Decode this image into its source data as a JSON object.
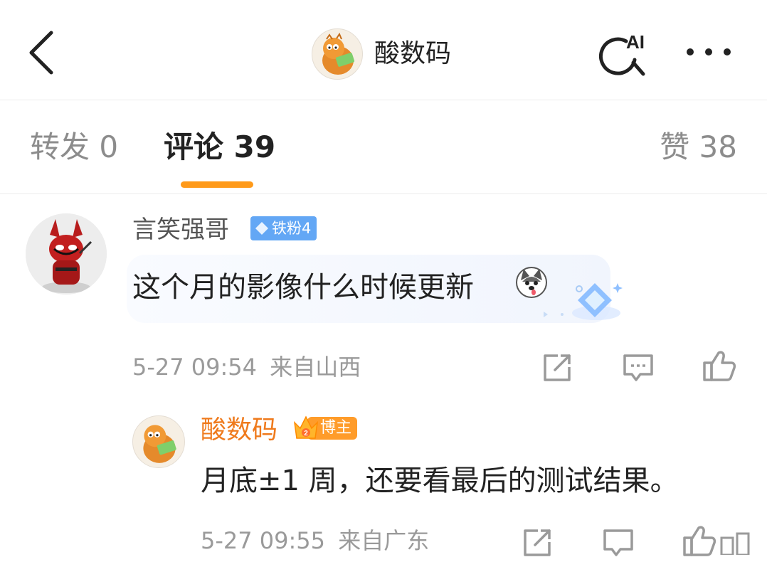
{
  "header": {
    "title": "酸数码"
  },
  "tabs": {
    "repost": "转发 0",
    "comment": "评论 39",
    "like": "赞 38"
  },
  "comments": [
    {
      "user": "言笑强哥",
      "badge": "铁粉4",
      "text": "这个月的影像什么时候更新",
      "time": "5-27 09:54",
      "location": "来自山西"
    }
  ],
  "reply": {
    "user": "酸数码",
    "badge": "博主",
    "text": "月底±1 周，还要看最后的测试结果。",
    "time": "5-27 09:55",
    "location": "来自广东"
  },
  "icons": [
    "back-arrow-icon",
    "ai-search-icon",
    "more-icon",
    "diamond-icon",
    "share-icon",
    "reply-icon",
    "like-icon",
    "crown-icon"
  ],
  "colors": {
    "accent": "#ff9a1a",
    "blogger_name": "#ef7a1c",
    "fan_badge": "#63a7f5"
  }
}
